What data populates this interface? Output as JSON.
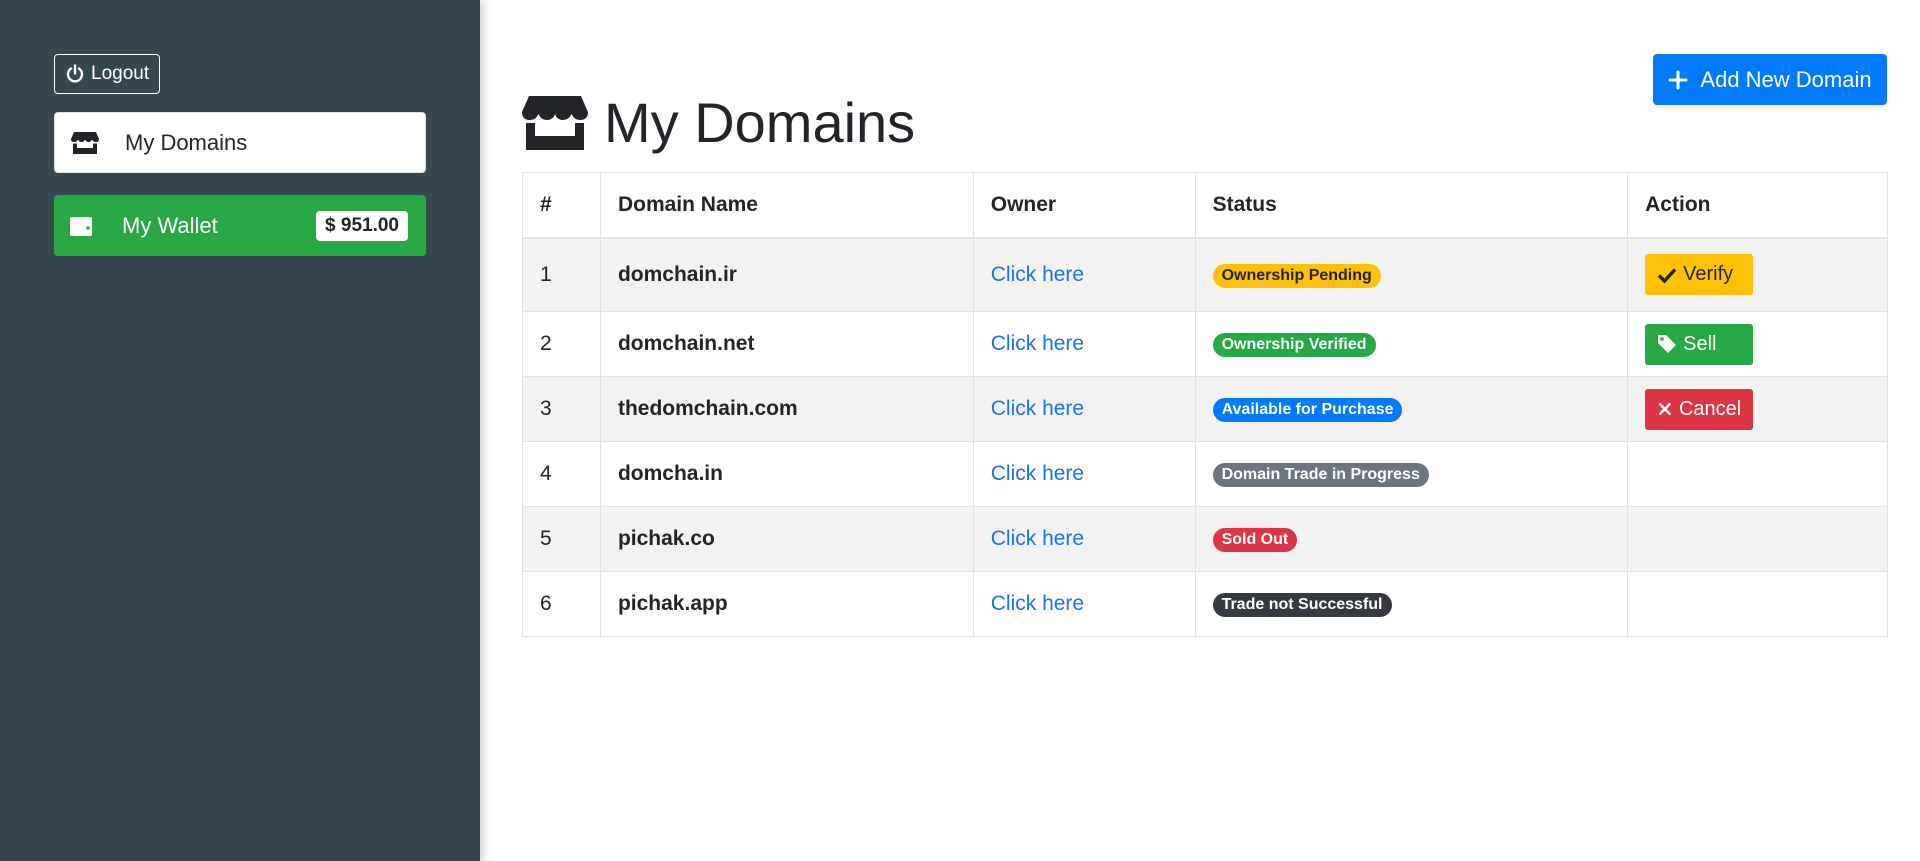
{
  "sidebar": {
    "logout_label": "Logout",
    "nav": [
      {
        "label": "My Domains",
        "icon": "store-icon"
      },
      {
        "label": "My Wallet",
        "icon": "wallet-icon",
        "balance": "$ 951.00"
      }
    ]
  },
  "header": {
    "title": "My Domains",
    "add_button_label": "Add New Domain"
  },
  "table": {
    "columns": [
      "#",
      "Domain Name",
      "Owner",
      "Status",
      "Action"
    ],
    "rows": [
      {
        "num": "1",
        "domain": "domchain.ir",
        "owner": "Click here",
        "status": "Ownership Pending",
        "action": "Verify"
      },
      {
        "num": "2",
        "domain": "domchain.net",
        "owner": "Click here",
        "status": "Ownership Verified",
        "action": "Sell"
      },
      {
        "num": "3",
        "domain": "thedomchain.com",
        "owner": "Click here",
        "status": "Available for Purchase",
        "action": "Cancel"
      },
      {
        "num": "4",
        "domain": "domcha.in",
        "owner": "Click here",
        "status": "Domain Trade in Progress",
        "action": ""
      },
      {
        "num": "5",
        "domain": "pichak.co",
        "owner": "Click here",
        "status": "Sold Out",
        "action": ""
      },
      {
        "num": "6",
        "domain": "pichak.app",
        "owner": "Click here",
        "status": "Trade not Successful",
        "action": ""
      }
    ]
  },
  "colors": {
    "sidebar_bg": "#37474f",
    "primary": "#007bff",
    "success": "#28a745",
    "warning": "#ffc107",
    "danger": "#dc3545",
    "secondary": "#6c757d",
    "dark": "#343a40",
    "link": "#1a73e8"
  }
}
